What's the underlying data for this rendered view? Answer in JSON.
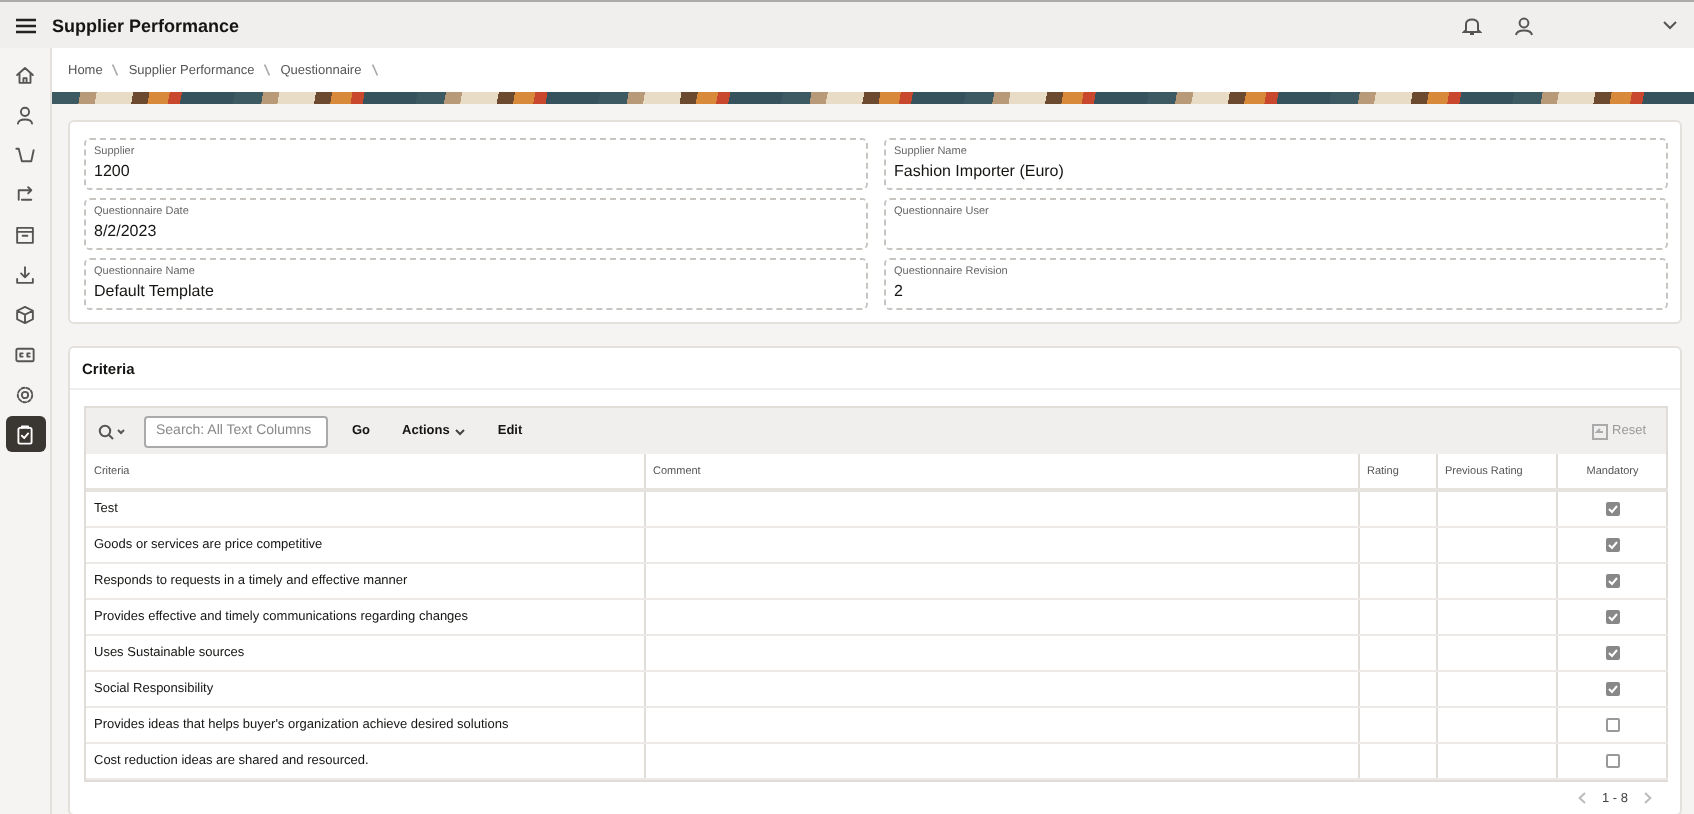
{
  "header": {
    "title": "Supplier Performance"
  },
  "sidebar": {
    "items": [
      {
        "selected": false
      },
      {
        "selected": false
      },
      {
        "selected": false
      },
      {
        "selected": false
      },
      {
        "selected": false
      },
      {
        "selected": false
      },
      {
        "selected": false
      },
      {
        "selected": false
      },
      {
        "selected": false
      },
      {
        "selected": true
      }
    ]
  },
  "breadcrumb": [
    "Home",
    "Supplier Performance",
    "Questionnaire"
  ],
  "form": {
    "fields": [
      {
        "label": "Supplier",
        "value": "1200"
      },
      {
        "label": "Supplier Name",
        "value": "Fashion Importer (Euro)"
      },
      {
        "label": "Questionnaire Date",
        "value": "8/2/2023"
      },
      {
        "label": "Questionnaire User"
      },
      {
        "label": "Questionnaire Name",
        "value": "Default Template"
      },
      {
        "label": "Questionnaire Revision",
        "value": "2"
      }
    ]
  },
  "criteria": {
    "title": "Criteria",
    "toolbar": {
      "search_placeholder": "Search: All Text Columns",
      "go": "Go",
      "actions": "Actions",
      "edit": "Edit",
      "reset": "Reset"
    },
    "columns": [
      "Criteria",
      "Comment",
      "Rating",
      "Previous Rating",
      "Mandatory"
    ],
    "rows": [
      {
        "criteria": "Test",
        "mandatory": true
      },
      {
        "criteria": "Goods or services are price competitive",
        "mandatory": true
      },
      {
        "criteria": "Responds to requests in a timely and effective manner",
        "mandatory": true
      },
      {
        "criteria": "Provides effective and timely communications regarding changes",
        "mandatory": true
      },
      {
        "criteria": "Uses Sustainable sources",
        "mandatory": true
      },
      {
        "criteria": "Social Responsibility",
        "mandatory": true
      },
      {
        "criteria": "Provides ideas that helps buyer's organization achieve desired solutions",
        "mandatory": false
      },
      {
        "criteria": "Cost reduction ideas are shared and resourced.",
        "mandatory": false
      }
    ],
    "pagination": "1 - 8"
  }
}
